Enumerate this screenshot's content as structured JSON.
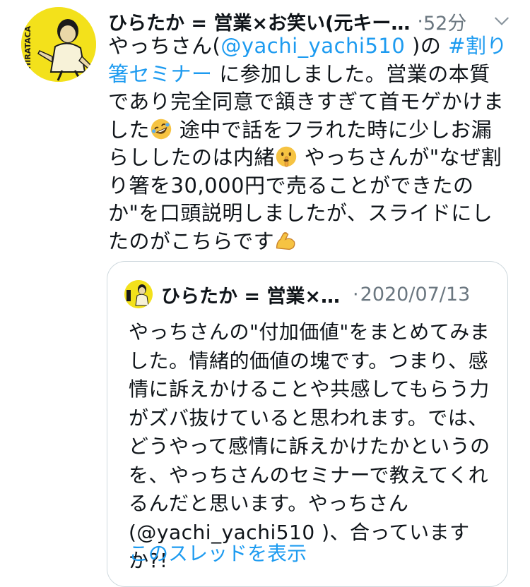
{
  "tweet": {
    "author": "ひらたか = 営業×お笑い(元キー…",
    "dot": "·",
    "time": "52分",
    "avatar_text": "HIRATACA",
    "body": {
      "part1": "やっちさん(",
      "mention1": "@yachi_yachi510",
      "part2": " )の ",
      "hashtag": "#割り箸セミナー",
      "part3": " に参加しました。営業の本質であり完全同意で頷きすぎて首モゲかけました",
      "part4": " 途中で話をフラれた時に少しお漏らししたのは内緒",
      "part5": " やっちさんが\"なぜ割り箸を30,000円で売ることができたのか\"を口頭説明しましたが、スライドにしたのがこちらです",
      "emoji1": "rofl-emoji",
      "emoji2": "shushing-face-emoji",
      "emoji3": "flexed-biceps-emoji"
    }
  },
  "quoted": {
    "author": "ひらたか = 営業×…",
    "dot": "·",
    "date": "2020/07/13",
    "body": "やっちさんの\"付加価値\"をまとめてみました。情緒的価値の塊です。つまり、感情に訴えかけることや共感してもらう力がズバ抜けていると思われます。では、どうやって感情に訴えかけたかというのを、やっちさんのセミナーで教えてくれるんだと思います。やっちさん(@yachi_yachi510 )、合っていますか?!",
    "show_thread": "このスレッドを表示"
  },
  "colors": {
    "link": "#1d9bf0",
    "muted": "#6b7780",
    "avatar_bg": "#f3e11b",
    "border": "#cfd9de"
  }
}
